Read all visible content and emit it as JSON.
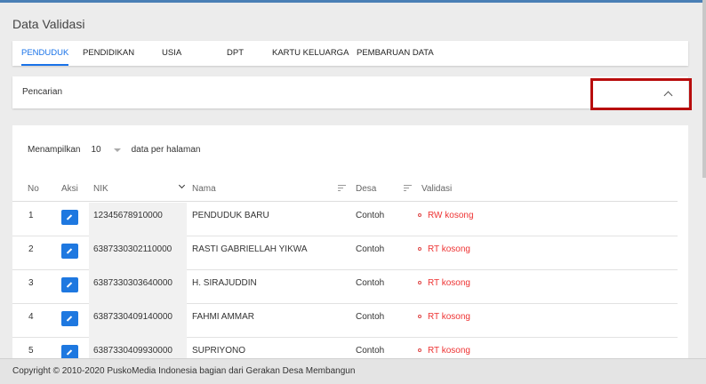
{
  "page": {
    "title": "Data Validasi"
  },
  "tabs": [
    {
      "label": "PENDUDUK",
      "active": true
    },
    {
      "label": "PENDIDIKAN",
      "active": false
    },
    {
      "label": "USIA",
      "active": false
    },
    {
      "label": "DPT",
      "active": false
    },
    {
      "label": "KARTU KELUARGA",
      "active": false
    },
    {
      "label": "PEMBARUAN DATA",
      "active": false
    }
  ],
  "search": {
    "label": "Pencarian",
    "toggle_icon": "chevron-up-icon"
  },
  "table_controls": {
    "prefix": "Menampilkan",
    "page_size": "10",
    "suffix": "data per halaman"
  },
  "columns": [
    "No",
    "Aksi",
    "NIK",
    "Nama",
    "Desa",
    "Validasi"
  ],
  "rows": [
    {
      "no": "1",
      "nik": "12345678910000",
      "nama": "PENDUDUK BARU",
      "desa": "Contoh",
      "validasi": "RW kosong"
    },
    {
      "no": "2",
      "nik": "6387330302110000",
      "nama": "RASTI GABRIELLAH YIKWA",
      "desa": "Contoh",
      "validasi": "RT kosong"
    },
    {
      "no": "3",
      "nik": "6387330303640000",
      "nama": "H. SIRAJUDDIN",
      "desa": "Contoh",
      "validasi": "RT kosong"
    },
    {
      "no": "4",
      "nik": "6387330409140000",
      "nama": "FAHMI AMMAR",
      "desa": "Contoh",
      "validasi": "RT kosong"
    },
    {
      "no": "5",
      "nik": "6387330409930000",
      "nama": "SUPRIYONO",
      "desa": "Contoh",
      "validasi": "RT kosong"
    }
  ],
  "footer": {
    "text": "Copyright © 2010-2020 PuskoMedia Indonesia bagian dari Gerakan Desa Membangun"
  },
  "colors": {
    "accent": "#1a73e8",
    "edit_button": "#1e78e0",
    "validation_error": "#e33333",
    "highlight_border": "#b80d0d"
  }
}
